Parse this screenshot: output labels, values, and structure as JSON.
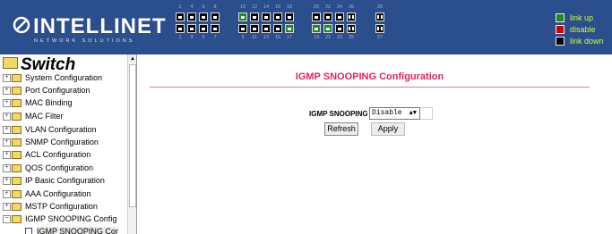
{
  "brand": {
    "logo_text": "INTELLINET",
    "tagline": "NETWORK SOLUTIONS",
    "header_color": "#2b4e8c"
  },
  "port_panel": {
    "top_numbers": [
      "2",
      "4",
      "6",
      "8",
      "10",
      "12",
      "14",
      "16",
      "18",
      "20",
      "22",
      "24",
      "26",
      "28"
    ],
    "bottom_numbers": [
      "1",
      "3",
      "5",
      "7",
      "9",
      "11",
      "13",
      "15",
      "17",
      "19",
      "21",
      "23",
      "25",
      "27"
    ],
    "ports_up": [
      "10",
      "17",
      "19",
      "21"
    ],
    "fiber_ports": [
      "25",
      "26",
      "27",
      "28"
    ]
  },
  "legend": [
    {
      "label": "link up",
      "color": "#1e8a1e"
    },
    {
      "label": "disable",
      "color": "#d40000"
    },
    {
      "label": "link down",
      "color": "#000000"
    }
  ],
  "tree": {
    "root": "Switch",
    "items": [
      {
        "label": "System Configuration"
      },
      {
        "label": "Port Configuration"
      },
      {
        "label": "MAC Binding"
      },
      {
        "label": "MAC Filter"
      },
      {
        "label": "VLAN Configuration"
      },
      {
        "label": "SNMP Configuration"
      },
      {
        "label": "ACL Configuration"
      },
      {
        "label": "QOS Configuration"
      },
      {
        "label": "IP Basic Configuration"
      },
      {
        "label": "AAA Configuration"
      },
      {
        "label": "MSTP Configuration"
      },
      {
        "label": "IGMP SNOOPING Config"
      }
    ],
    "leaf": "IGMP SNOOPING Cor"
  },
  "main": {
    "title": "IGMP SNOOPING Configuration",
    "field_label": "IGMP SNOOPING",
    "select_value": "Disable",
    "refresh_label": "Refresh",
    "apply_label": "Apply"
  }
}
